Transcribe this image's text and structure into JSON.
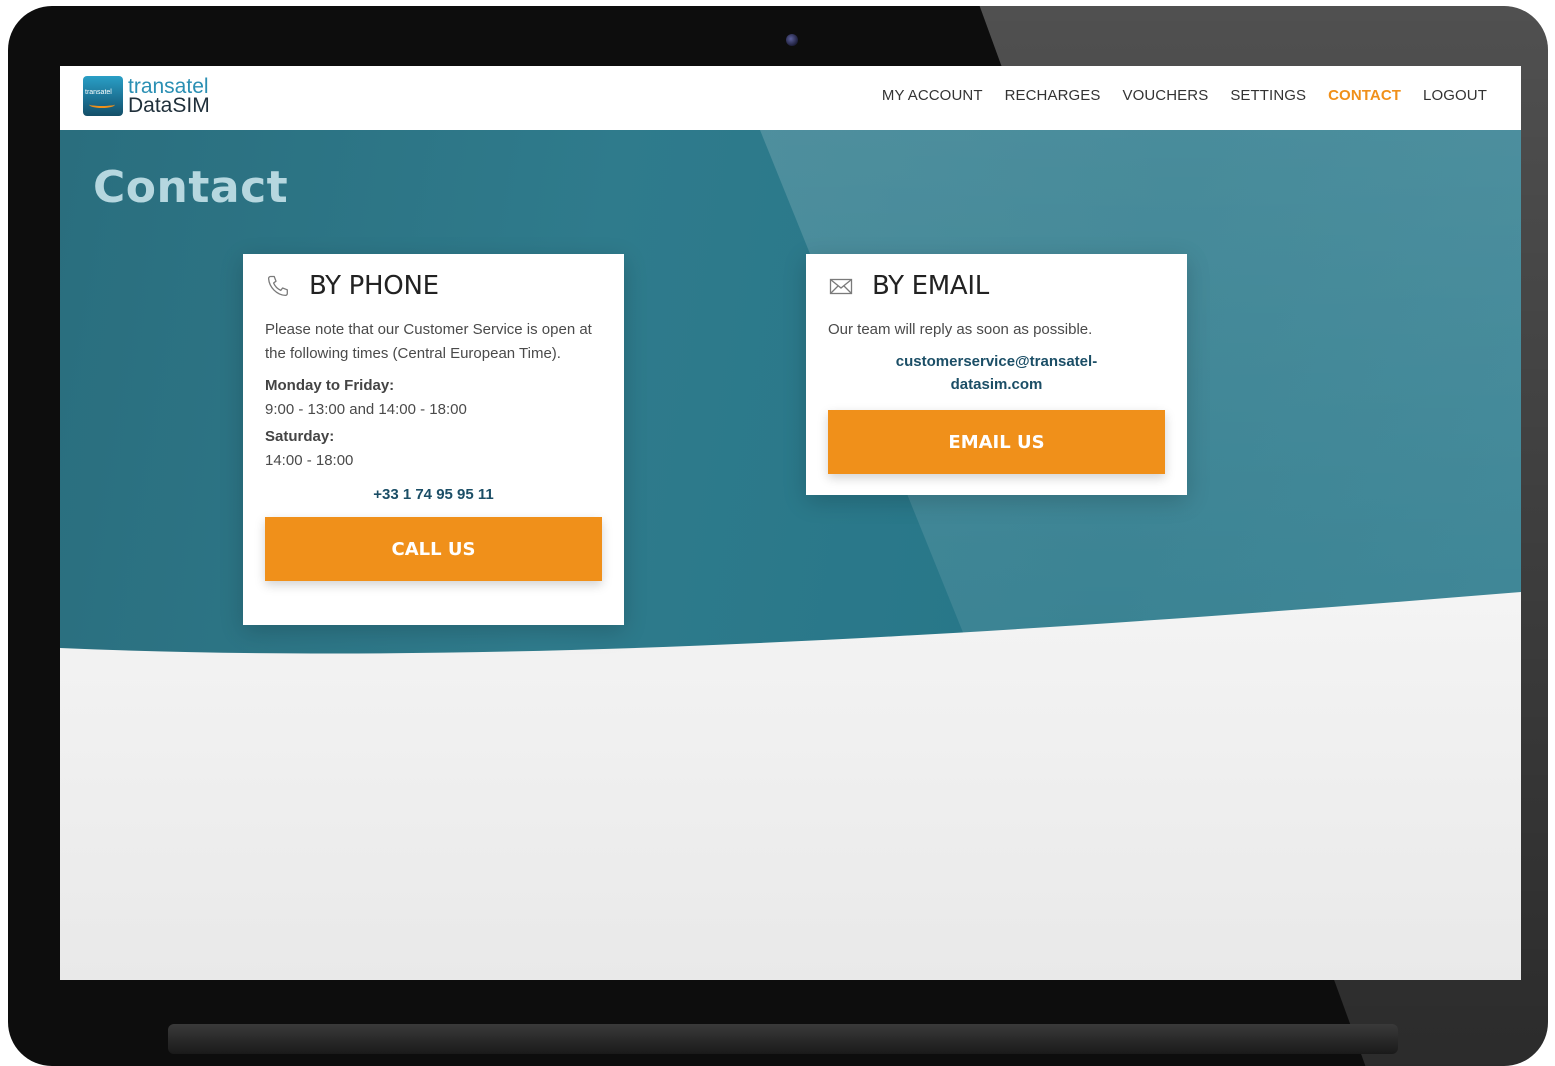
{
  "brand": {
    "badge_text": "transatel",
    "name_line1": "transatel",
    "name_line2": "DataSIM"
  },
  "nav": {
    "items": [
      {
        "label": "MY ACCOUNT",
        "active": false
      },
      {
        "label": "RECHARGES",
        "active": false
      },
      {
        "label": "VOUCHERS",
        "active": false
      },
      {
        "label": "SETTINGS",
        "active": false
      },
      {
        "label": "CONTACT",
        "active": true
      },
      {
        "label": "LOGOUT",
        "active": false
      }
    ]
  },
  "page": {
    "title": "Contact"
  },
  "phone_card": {
    "icon": "phone-icon",
    "title": "BY PHONE",
    "intro": "Please note that our Customer Service is open at the following times (Central European Time).",
    "weekday_label": "Monday to Friday:",
    "weekday_hours": "9:00 - 13:00 and 14:00 - 18:00",
    "saturday_label": "Saturday:",
    "saturday_hours": "14:00 - 18:00",
    "phone_number": "+33 1 74 95 95 11",
    "button_label": "CALL US"
  },
  "email_card": {
    "icon": "envelope-icon",
    "title": "BY EMAIL",
    "intro": "Our team will reply as soon as possible.",
    "email_line1": "customerservice@transatel-",
    "email_line2": "datasim.com",
    "button_label": "EMAIL US"
  },
  "colors": {
    "accent": "#f0901a",
    "hero": "#2f7b8c",
    "link": "#1b4e66"
  }
}
